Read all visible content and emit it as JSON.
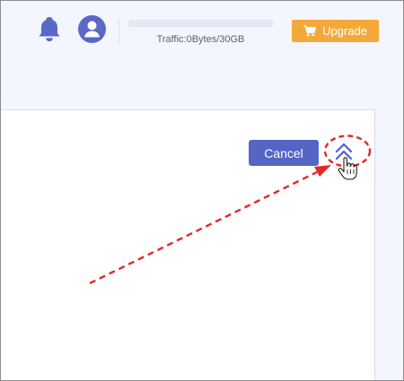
{
  "header": {
    "bell_icon": "bell-icon",
    "avatar_icon": "user-icon",
    "traffic": {
      "label": "Traffic:0Bytes/30GB",
      "used_fraction": 0
    },
    "upgrade": {
      "label": "Upgrade",
      "icon": "cart-icon",
      "color": "#f5a83a"
    }
  },
  "toolbar": {
    "cancel_label": "Cancel",
    "cancel_color": "#5665c4",
    "collapse_icon": "double-chevron-up-icon"
  },
  "annotation": {
    "color": "#e42828",
    "shapes": [
      "dashed-ellipse",
      "dashed-arrow"
    ],
    "pointer_icon": "hand-pointer-icon"
  }
}
